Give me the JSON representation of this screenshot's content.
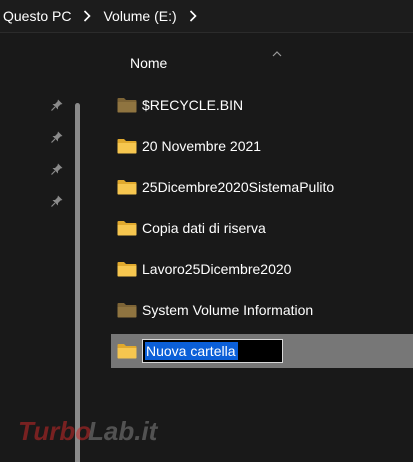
{
  "breadcrumb": {
    "items": [
      {
        "label": "Questo PC"
      },
      {
        "label": "Volume (E:)"
      }
    ]
  },
  "list": {
    "column_header": "Nome",
    "rows": [
      {
        "label": "$RECYCLE.BIN",
        "icon": "system-folder-icon"
      },
      {
        "label": "20 Novembre 2021",
        "icon": "folder-icon"
      },
      {
        "label": "25Dicembre2020SistemaPulito",
        "icon": "folder-icon"
      },
      {
        "label": "Copia dati di riserva",
        "icon": "folder-icon"
      },
      {
        "label": "Lavoro25Dicembre2020",
        "icon": "folder-icon"
      },
      {
        "label": "System Volume Information",
        "icon": "system-folder-icon"
      }
    ],
    "renaming_row": {
      "value": "Nuova cartella",
      "icon": "folder-icon"
    }
  },
  "colors": {
    "background": "#191919",
    "folder": "#f4c34e",
    "system_folder": "#8a6e3a",
    "selection": "#0b5fd8",
    "row_selected": "#777777"
  },
  "watermark": {
    "text": "TurboLab.it"
  }
}
